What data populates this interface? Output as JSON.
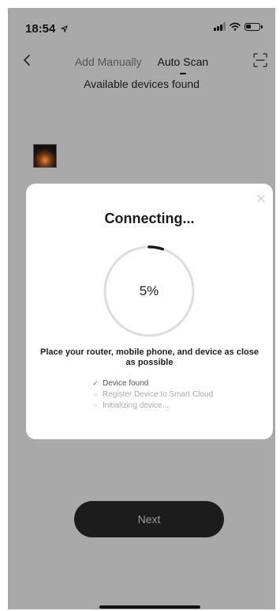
{
  "status_bar": {
    "time": "18:54",
    "icons": [
      "location-arrow-icon",
      "signal-icon",
      "wifi-icon",
      "battery-icon"
    ]
  },
  "header": {
    "back_icon": "chevron-left-icon",
    "tabs": [
      {
        "label": "Add Manually",
        "active": false
      },
      {
        "label": "Auto Scan",
        "active": true
      }
    ],
    "scan_icon": "scan-icon"
  },
  "subtitle": "Available devices found",
  "dialog": {
    "title": "Connecting...",
    "progress_percent": 5,
    "progress_label": "5%",
    "instruction": "Place your router, mobile phone, and device as close as possible",
    "steps": [
      {
        "label": "Device found",
        "done": true
      },
      {
        "label": "Register Device to Smart Cloud",
        "done": false
      },
      {
        "label": "Initializing device...",
        "done": false
      }
    ]
  },
  "next_button": "Next",
  "colors": {
    "overlay": "#a9a9a9",
    "dialog_bg": "#ffffff",
    "button_bg": "#1c1c1c",
    "progress_track": "#dddddd",
    "progress_fill": "#1a1a1a"
  }
}
